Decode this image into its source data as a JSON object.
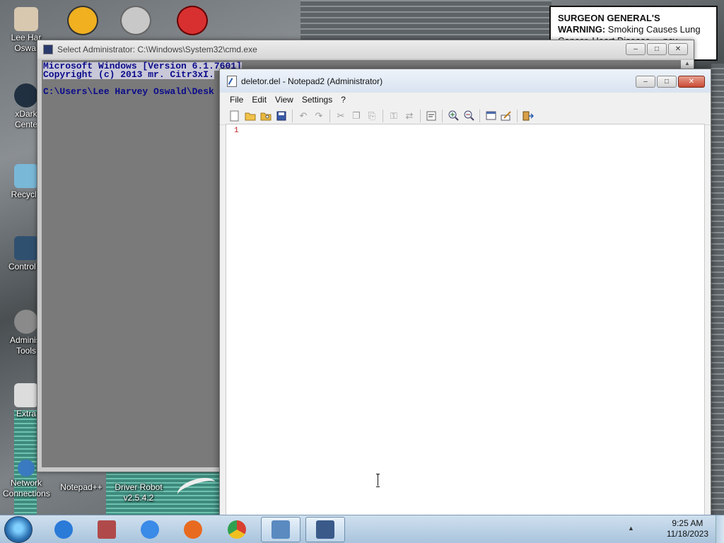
{
  "desktop": {
    "icons": [
      {
        "label": "Lee Har\nOswal",
        "color": "#d8c8b0"
      },
      {
        "label": "xDark\nCente",
        "color": "#203040"
      },
      {
        "label": "Recycle",
        "color": "#7ab8d8"
      },
      {
        "label": "Control P",
        "color": "#305070"
      },
      {
        "label": "Administ\nTools",
        "color": "#8a8a8a"
      },
      {
        "label": "Extra",
        "color": "#dcdcdc"
      },
      {
        "label": "Network\nConnections",
        "color": "#3a7ac0"
      },
      {
        "label": "Notepad++",
        "color": "#e8e8d8"
      },
      {
        "label": "Driver Robot\nv2.5.4.2",
        "color": "#4a8ad0"
      }
    ],
    "warning": {
      "heading": "SURGEON GENERAL'S WARNING:",
      "text": "Smoking Causes Lung Cancer, Heart Disease, ...ncy."
    }
  },
  "cmd_window": {
    "title": "Select Administrator: C:\\Windows\\System32\\cmd.exe",
    "lines": [
      "Microsoft Windows [Version 6.1.7601]",
      "Copyright (c) 2013 mr. Citr3xI.",
      "",
      "C:\\Users\\Lee Harvey Oswald\\Desk"
    ],
    "buttons": {
      "minimize": "–",
      "maximize": "□",
      "close": "✕"
    }
  },
  "notepad": {
    "title": "deletor.del - Notepad2 (Administrator)",
    "menu": [
      "File",
      "Edit",
      "View",
      "Settings",
      "?"
    ],
    "line_number": "1",
    "content": "",
    "buttons": {
      "minimize": "–",
      "maximize": "□",
      "close": "✕"
    }
  },
  "taskbar": {
    "apps": [
      {
        "name": "internet-explorer",
        "color": "#2a7ad8"
      },
      {
        "name": "archive",
        "color": "#b04a4a"
      },
      {
        "name": "itunes",
        "color": "#3a8ae8"
      },
      {
        "name": "firefox",
        "color": "#e86a20"
      },
      {
        "name": "chrome",
        "color": "#d84030"
      },
      {
        "name": "notepad2",
        "color": "#5a8ac0"
      },
      {
        "name": "cmd",
        "color": "#3a5a8a"
      }
    ],
    "time": "9:25 AM",
    "date": "11/18/2023"
  }
}
